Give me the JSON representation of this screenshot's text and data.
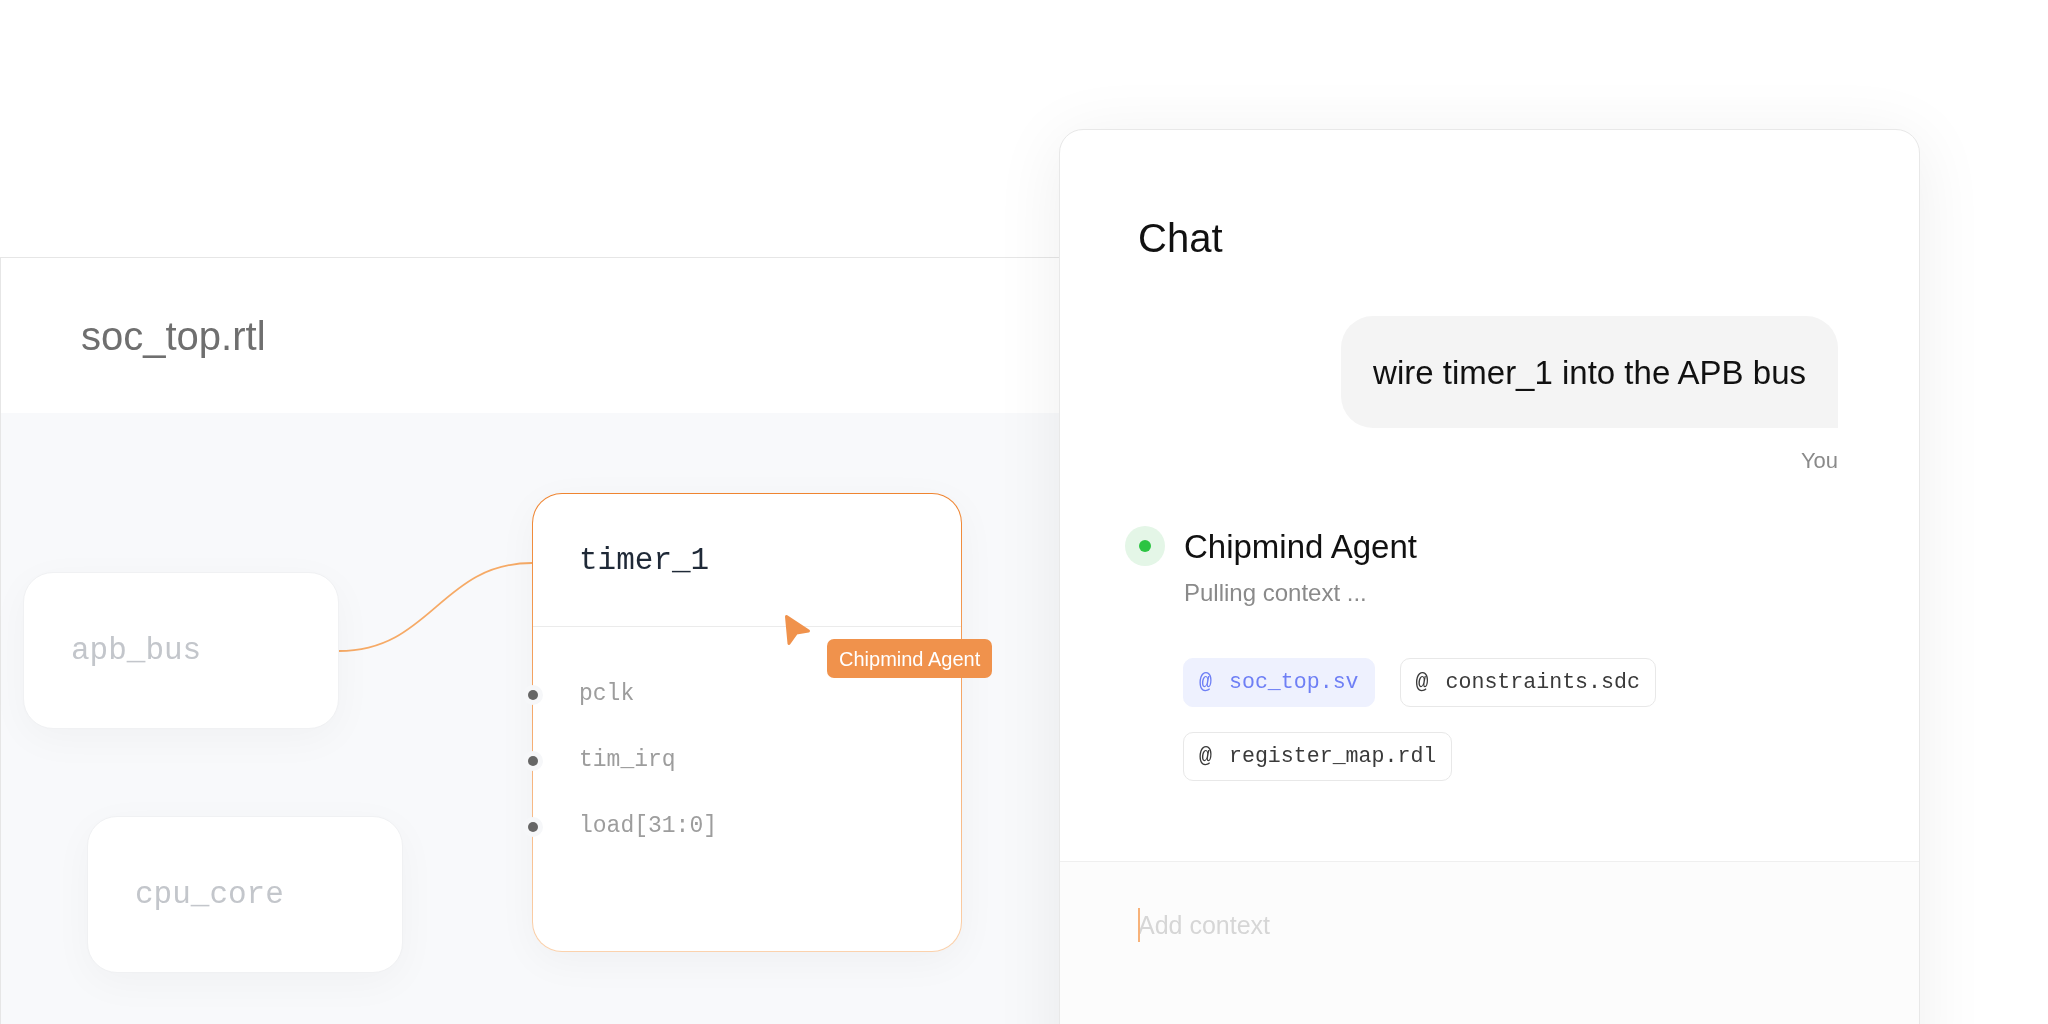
{
  "editor": {
    "title": "soc_top.rtl",
    "nodes": [
      {
        "name": "apb_bus",
        "selected": false
      },
      {
        "name": "cpu_core",
        "selected": false
      },
      {
        "name": "timer_1",
        "selected": true,
        "ports": [
          "pclk",
          "tim_irq",
          "load[31:0]"
        ]
      }
    ],
    "cursor": {
      "label": "Chipmind Agent"
    }
  },
  "chat": {
    "title": "Chat",
    "messages": [
      {
        "kind": "user",
        "text": "wire timer_1 into the APB bus",
        "author": "You"
      },
      {
        "kind": "agent",
        "author": "Chipmind Agent",
        "status": "Pulling context ...",
        "online": true,
        "context": [
          {
            "prefix": "@",
            "file": "soc_top.sv",
            "selected": true
          },
          {
            "prefix": "@",
            "file": "constraints.sdc",
            "selected": false
          },
          {
            "prefix": "@",
            "file": "register_map.rdl",
            "selected": false
          }
        ]
      }
    ],
    "input": {
      "placeholder": "Add context",
      "focused": true
    }
  }
}
